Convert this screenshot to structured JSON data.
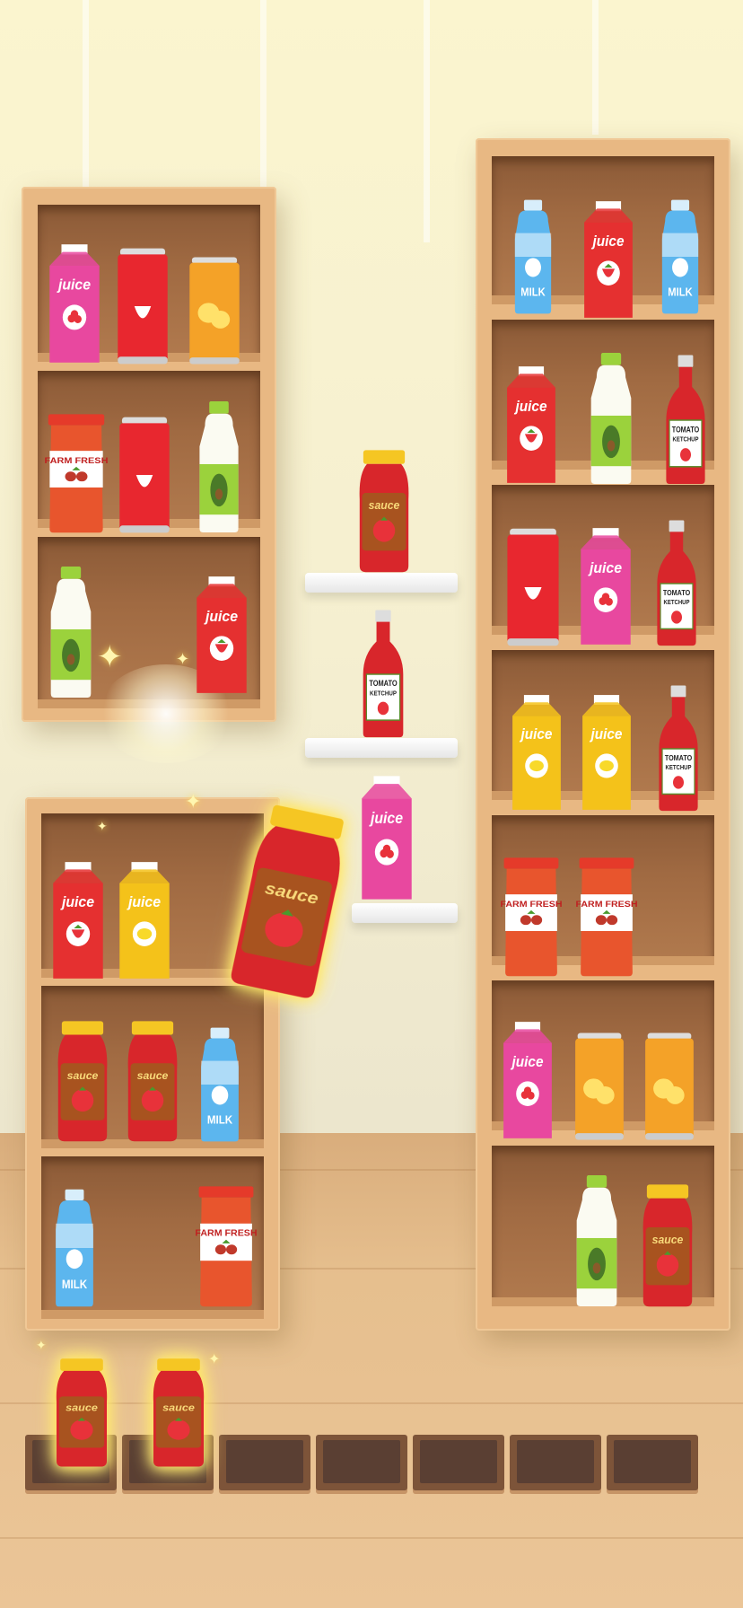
{
  "labels": {
    "juice": "juice",
    "milk": "MILK",
    "farm_fresh": "FARM FRESH",
    "sauce": "sauce",
    "tomato": "TOMATO",
    "ketchup": "KETCHUP"
  },
  "colors": {
    "juice_pink": "#e8489f",
    "juice_red": "#e53030",
    "juice_yellow": "#f4c21a",
    "milk_blue": "#5cb6ee",
    "avocado_green": "#9bd23c",
    "soda_orange": "#f4a228",
    "sauce_red": "#d8262b",
    "farm_red": "#e8552d",
    "tray_slot": "#5a3f33"
  },
  "tray": {
    "slots": 7,
    "filled": [
      "sauce-jar",
      "sauce-jar"
    ]
  },
  "held_item": "sauce-jar"
}
